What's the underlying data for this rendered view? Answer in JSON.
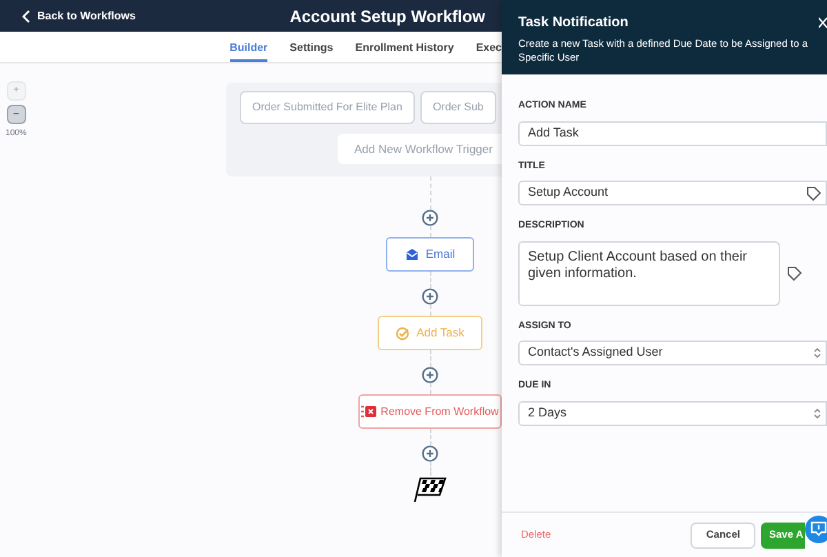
{
  "header": {
    "back": "Back to Workflows",
    "title": "Account Setup Workflow"
  },
  "tabs": [
    {
      "label": "Builder",
      "selected": true
    },
    {
      "label": "Settings",
      "selected": false
    },
    {
      "label": "Enrollment History",
      "selected": false
    },
    {
      "label": "Exec",
      "selected": false
    }
  ],
  "zoom": {
    "plus": "+",
    "minus": "−",
    "level": "100%"
  },
  "triggers": [
    "Order Submitted For Elite Plan",
    "Order Sub"
  ],
  "add_trigger": "Add New Workflow Trigger",
  "actions": [
    {
      "kind": "email",
      "label": "Email"
    },
    {
      "kind": "task",
      "label": "Add Task"
    },
    {
      "kind": "remove",
      "label": "Remove From Workflow"
    }
  ],
  "panel": {
    "title": "Task Notification",
    "subtitle": "Create a new Task with a defined Due Date to be Assigned to a Specific User",
    "fields": [
      {
        "kind": "input",
        "label": "ACTION NAME",
        "value": "Add Task"
      },
      {
        "kind": "tag-input",
        "label": "TITLE",
        "value": "Setup Account"
      },
      {
        "kind": "textarea",
        "label": "DESCRIPTION",
        "value": "Setup Client Account based on their given information."
      },
      {
        "kind": "select",
        "label": "ASSIGN TO",
        "value": "Contact's Assigned User"
      },
      {
        "kind": "select",
        "label": "DUE IN",
        "value": "2 Days"
      }
    ],
    "delete": "Delete",
    "cancel": "Cancel",
    "save": "Save A"
  }
}
